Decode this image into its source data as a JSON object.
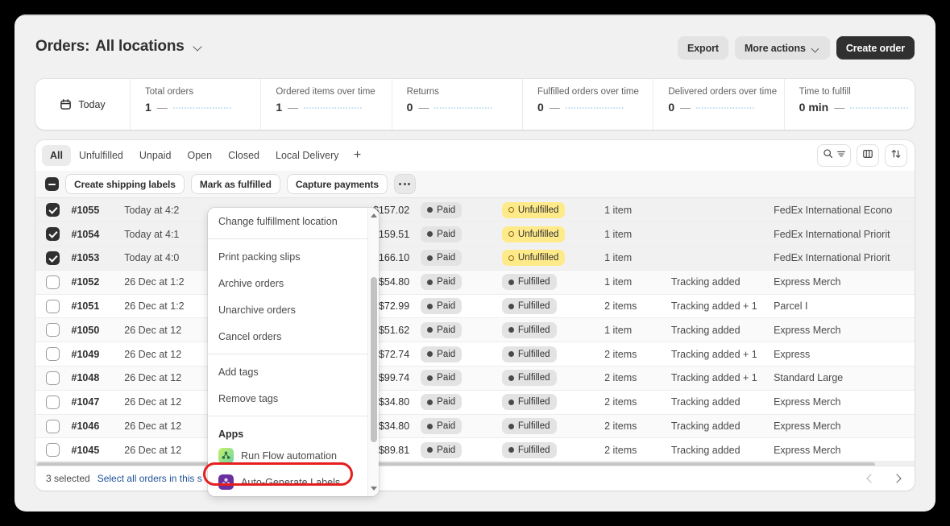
{
  "header": {
    "title_prefix": "Orders:",
    "title_main": "All locations",
    "chevron_icon": "chevron-down-icon",
    "export_label": "Export",
    "more_actions_label": "More actions",
    "create_order_label": "Create order"
  },
  "metrics": {
    "today_label": "Today",
    "today_icon": "calendar-icon",
    "items": [
      {
        "label": "Total orders",
        "value": "1",
        "dash": "—"
      },
      {
        "label": "Ordered items over time",
        "value": "1",
        "dash": "—"
      },
      {
        "label": "Returns",
        "value": "0",
        "dash": "—"
      },
      {
        "label": "Fulfilled orders over time",
        "value": "0",
        "dash": "—"
      },
      {
        "label": "Delivered orders over time",
        "value": "0",
        "dash": "—"
      },
      {
        "label": "Time to fulfill",
        "value": "0 min",
        "dash": "—"
      }
    ]
  },
  "tabs": {
    "items": [
      {
        "label": "All",
        "active": true
      },
      {
        "label": "Unfulfilled",
        "active": false
      },
      {
        "label": "Unpaid",
        "active": false
      },
      {
        "label": "Open",
        "active": false
      },
      {
        "label": "Closed",
        "active": false
      },
      {
        "label": "Local Delivery",
        "active": false
      }
    ],
    "add_label": "+",
    "search_icon": "search-icon",
    "filter_icon": "filter-lines-icon",
    "columns_icon": "columns-icon",
    "sort_icon": "sort-arrows-icon"
  },
  "bulk_actions": {
    "select_all_state": "indeterminate",
    "buttons": [
      "Create shipping labels",
      "Mark as fulfilled",
      "Capture payments"
    ],
    "more_icon": "ellipsis-icon"
  },
  "menu": {
    "sections": [
      {
        "items": [
          {
            "label": "Change fulfillment location",
            "icon": null
          }
        ]
      },
      {
        "items": [
          {
            "label": "Print packing slips",
            "icon": null
          },
          {
            "label": "Archive orders",
            "icon": null
          },
          {
            "label": "Unarchive orders",
            "icon": null
          },
          {
            "label": "Cancel orders",
            "icon": null
          }
        ]
      },
      {
        "items": [
          {
            "label": "Add tags",
            "icon": null
          },
          {
            "label": "Remove tags",
            "icon": null
          }
        ]
      }
    ],
    "apps_heading": "Apps",
    "apps": [
      {
        "label": "Run Flow automation",
        "icon": "flow-app-icon",
        "color": "#a6e04a"
      },
      {
        "label": "Auto-Generate Labels",
        "icon": "labels-app-icon",
        "color": "#6b2fa0"
      }
    ],
    "highlight_color": "#e51e1e",
    "scroll_up_icon": "triangle-up-icon",
    "scroll_down_icon": "triangle-down-icon"
  },
  "table": {
    "rows": [
      {
        "selected": true,
        "order": "#1055",
        "date": "Today at 4:2",
        "customer": "",
        "total": "$157.02",
        "payment": "Paid",
        "fulfillment": "Unfulfilled",
        "fulfilled": false,
        "items": "1 item",
        "tracking": "",
        "delivery": "FedEx International Econo"
      },
      {
        "selected": true,
        "order": "#1054",
        "date": "Today at 4:1",
        "customer": "",
        "total": "$159.51",
        "payment": "Paid",
        "fulfillment": "Unfulfilled",
        "fulfilled": false,
        "items": "1 item",
        "tracking": "",
        "delivery": "FedEx International Priorit"
      },
      {
        "selected": true,
        "order": "#1053",
        "date": "Today at 4:0",
        "customer": "",
        "total": "$166.10",
        "payment": "Paid",
        "fulfillment": "Unfulfilled",
        "fulfilled": false,
        "items": "1 item",
        "tracking": "",
        "delivery": "FedEx International Priorit"
      },
      {
        "selected": false,
        "order": "#1052",
        "date": "26 Dec at 1:2",
        "customer": "",
        "total": "$54.80",
        "payment": "Paid",
        "fulfillment": "Fulfilled",
        "fulfilled": true,
        "items": "1 item",
        "tracking": "Tracking added",
        "delivery": "Express Merch"
      },
      {
        "selected": false,
        "order": "#1051",
        "date": "26 Dec at 1:2",
        "customer": "",
        "total": "$72.99",
        "payment": "Paid",
        "fulfillment": "Fulfilled",
        "fulfilled": true,
        "items": "2 items",
        "tracking": "Tracking added + 1",
        "delivery": "Parcel I"
      },
      {
        "selected": false,
        "order": "#1050",
        "date": "26 Dec at 12",
        "customer": "",
        "total": "$51.62",
        "payment": "Paid",
        "fulfillment": "Fulfilled",
        "fulfilled": true,
        "items": "1 item",
        "tracking": "Tracking added",
        "delivery": "Express Merch"
      },
      {
        "selected": false,
        "order": "#1049",
        "date": "26 Dec at 12",
        "customer": "",
        "total": "$72.74",
        "payment": "Paid",
        "fulfillment": "Fulfilled",
        "fulfilled": true,
        "items": "2 items",
        "tracking": "Tracking added + 1",
        "delivery": "Express"
      },
      {
        "selected": false,
        "order": "#1048",
        "date": "26 Dec at 12",
        "customer": "",
        "total": "$99.74",
        "payment": "Paid",
        "fulfillment": "Fulfilled",
        "fulfilled": true,
        "items": "2 items",
        "tracking": "Tracking added + 1",
        "delivery": "Standard Large"
      },
      {
        "selected": false,
        "order": "#1047",
        "date": "26 Dec at 12",
        "customer": "",
        "total": "$34.80",
        "payment": "Paid",
        "fulfillment": "Fulfilled",
        "fulfilled": true,
        "items": "2 items",
        "tracking": "Tracking added",
        "delivery": "Express Merch"
      },
      {
        "selected": false,
        "order": "#1046",
        "date": "26 Dec at 12",
        "customer": "",
        "total": "$34.80",
        "payment": "Paid",
        "fulfillment": "Fulfilled",
        "fulfilled": true,
        "items": "2 items",
        "tracking": "Tracking added",
        "delivery": "Express Merch"
      },
      {
        "selected": false,
        "order": "#1045",
        "date": "26 Dec at 12",
        "customer": "",
        "total": "$89.81",
        "payment": "Paid",
        "fulfillment": "Fulfilled",
        "fulfilled": true,
        "items": "2 items",
        "tracking": "Tracking added",
        "delivery": "Express Merch"
      }
    ]
  },
  "footer": {
    "selected_text": "3 selected",
    "select_all_link": "Select all orders in this s",
    "prev_icon": "chevron-left-icon",
    "next_icon": "chevron-right-icon"
  }
}
